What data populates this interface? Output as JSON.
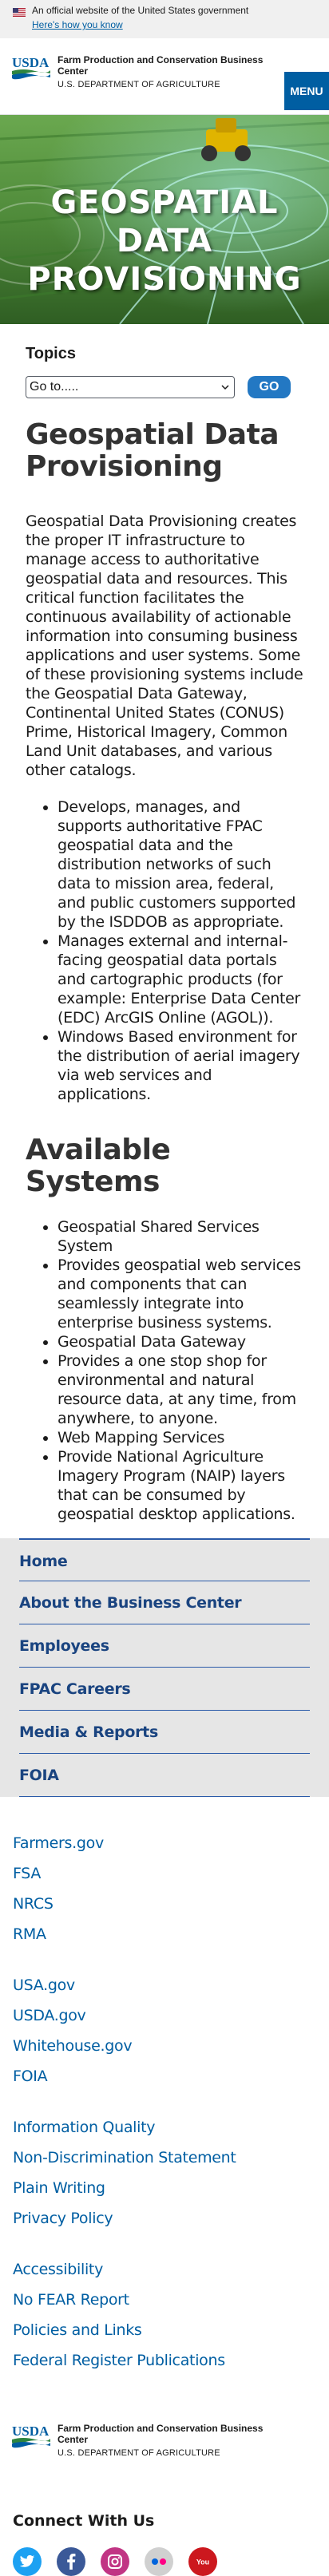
{
  "gov_banner": {
    "text": "An official website of the United States government",
    "link": "Here's how you know"
  },
  "header": {
    "logo_text": "USDA",
    "agency_name": "Farm Production and Conservation Business Center",
    "department": "U.S. DEPARTMENT OF AGRICULTURE",
    "menu_label": "MENU"
  },
  "hero": {
    "title_line1": "GEOSPATIAL DATA",
    "title_line2": "PROVISIONING"
  },
  "topics": {
    "label": "Topics",
    "select_value": "Go to.....",
    "go_label": "GO"
  },
  "main": {
    "title": "Geospatial Data Provisioning",
    "intro": "Geospatial Data Provisioning creates the proper IT infrastructure to manage access to authoritative geospatial data and resources. This critical function facilitates the continuous availability of actionable information into consuming business applications and user systems. Some of these provisioning systems include the Geospatial Data Gateway, Continental United States (CONUS) Prime, Historical Imagery, Common Land Unit databases, and various other catalogs.",
    "bullets": [
      "Develops, manages, and supports authoritative FPAC geospatial data and the distribution networks of such data to mission area, federal, and public customers supported by the ISDDOB as appropriate.",
      "Manages external and internal-facing geospatial data portals and cartographic products (for example: Enterprise Data Center (EDC) ArcGIS Online (AGOL)).",
      "Windows Based environment for the distribution of aerial imagery via web services and applications."
    ],
    "systems_title": "Available Systems",
    "systems": [
      "Geospatial Shared Services System",
      "Provides geospatial web services and components that can seamlessly integrate into enterprise business systems.",
      "Geospatial Data Gateway",
      "Provides a one stop shop for environmental and natural resource data, at any time, from anywhere, to anyone.",
      "Web Mapping Services",
      "Provide National Agriculture Imagery Program (NAIP) layers that can be consumed by geospatial desktop applications."
    ]
  },
  "sidenav": [
    "Home",
    "About the Business Center",
    "Employees",
    "FPAC Careers",
    "Media & Reports",
    "FOIA"
  ],
  "footer": {
    "group1": [
      "Farmers.gov",
      "FSA",
      "NRCS",
      "RMA"
    ],
    "group2": [
      "USA.gov",
      "USDA.gov",
      "Whitehouse.gov",
      "FOIA"
    ],
    "group3": [
      "Information Quality",
      "Non-Discrimination Statement",
      "Plain Writing",
      "Privacy Policy"
    ],
    "group4": [
      "Accessibility",
      "No FEAR Report",
      "Policies and Links",
      "Federal Register Publications"
    ],
    "connect_title": "Connect With Us",
    "social": [
      {
        "icon": "twitter-icon",
        "color": "#1da1f2"
      },
      {
        "icon": "facebook-icon",
        "color": "#3b5998"
      },
      {
        "icon": "instagram-icon",
        "color": "#c13584"
      },
      {
        "icon": "flickr-icon",
        "color": "#d0d0d0"
      },
      {
        "icon": "youtube-icon",
        "color": "#cc181e"
      }
    ]
  },
  "colors": {
    "primary": "#005ea2",
    "nav_text": "#1a4480",
    "go_button": "#2378c3"
  }
}
